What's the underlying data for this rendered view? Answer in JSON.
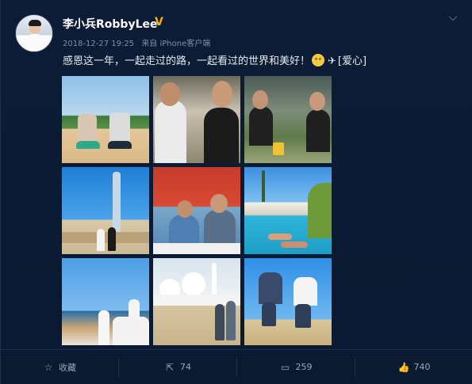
{
  "post": {
    "username": "李小兵RobbyLee",
    "verified_badge": "V",
    "timestamp": "2018-12-27 19:25",
    "source": "来自 iPhone客户端",
    "text_main": "感恩这一年，一起走过的路，一起看过的世界和美好！",
    "text_tag": "[爱心]",
    "menu_icon": "chevron-down-icon"
  },
  "actions": {
    "favorite_label": "收藏",
    "repost_count": "74",
    "comment_count": "259",
    "like_count": "740"
  },
  "colors": {
    "background": "#0b1b33",
    "badge": "#f7b500",
    "meta_text": "#7f8ea3",
    "action_text": "#9aa7ba"
  }
}
